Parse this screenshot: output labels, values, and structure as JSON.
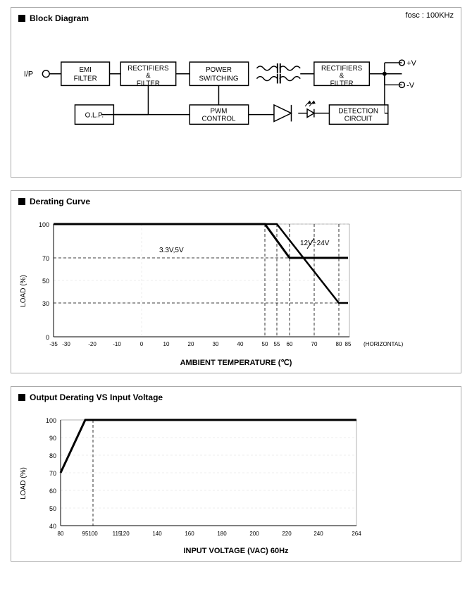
{
  "block_diagram": {
    "section_title": "Block Diagram",
    "fosc_label": "fosc : 100KHz",
    "blocks": {
      "ip": "I/P",
      "emi_filter": "EMI\nFILTER",
      "rect_filter_left": "RECTIFIERS\n&\nFILTER",
      "power_switching": "POWER\nSWITCHING",
      "rect_filter_right": "RECTIFIERS\n&\nFILTER",
      "olp": "O.L.P.",
      "pwm_control": "PWM\nCONTROL",
      "detection_circuit": "DETECTION\nCIRCUIT",
      "plus_v": "+V",
      "minus_v": "-V"
    }
  },
  "derating_curve": {
    "section_title": "Derating Curve",
    "y_axis_label": "LOAD (%)",
    "x_axis_label": "AMBIENT TEMPERATURE (℃)",
    "y_ticks": [
      "100",
      "70",
      "50",
      "30",
      "0"
    ],
    "x_ticks": [
      "-35",
      "-30",
      "-20",
      "-10",
      "0",
      "10",
      "20",
      "30",
      "40",
      "50 55 60",
      "70",
      "80 85"
    ],
    "x_axis_suffix": "(HORIZONTAL)",
    "curve_labels": {
      "label1": "3.3V,5V",
      "label2": "12V~24V"
    }
  },
  "output_derating": {
    "section_title": "Output Derating VS Input Voltage",
    "y_axis_label": "LOAD (%)",
    "x_axis_label": "INPUT VOLTAGE (VAC) 60Hz",
    "y_ticks": [
      "100",
      "90",
      "80",
      "70",
      "60",
      "50",
      "40"
    ],
    "x_ticks": [
      "80",
      "95",
      "100",
      "115",
      "120",
      "140",
      "160",
      "180",
      "200",
      "220",
      "240",
      "264"
    ]
  }
}
